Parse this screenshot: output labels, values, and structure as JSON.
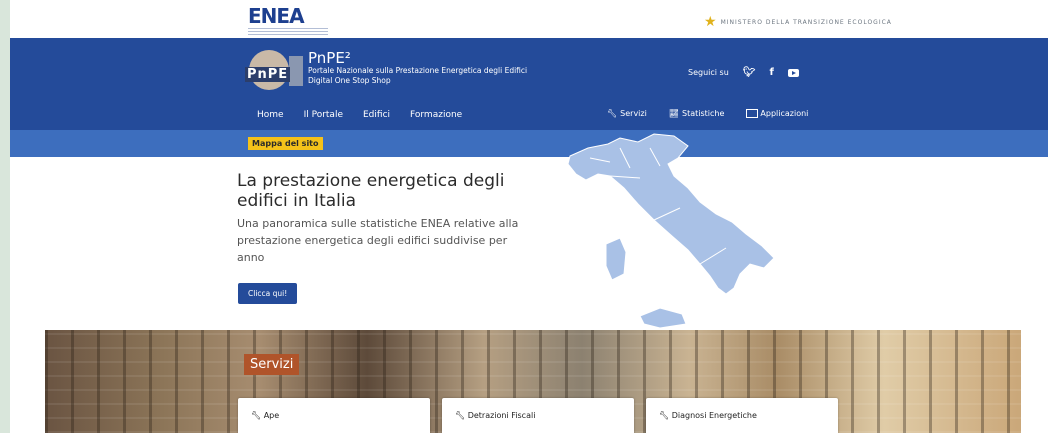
{
  "top": {
    "logo_text": "ENEA",
    "ministero_text": "MINISTERO DELLA TRANSIZIONE ECOLOGICA"
  },
  "header": {
    "logo_text": "PnPE",
    "title": "PnPE²",
    "subtitle_line1": "Portale Nazionale sulla Prestazione Energetica degli Edifici",
    "subtitle_line2": "Digital One Stop Shop",
    "follow_label": "Seguici su"
  },
  "nav": {
    "items": [
      {
        "label": "Home"
      },
      {
        "label": "Il Portale"
      },
      {
        "label": "Edifici"
      },
      {
        "label": "Formazione"
      }
    ],
    "right_items": [
      {
        "label": "Servizi",
        "icon": "wrench-icon"
      },
      {
        "label": "Statistiche",
        "icon": "chart-icon"
      },
      {
        "label": "Applicazioni",
        "icon": "window-icon"
      }
    ]
  },
  "sitemap_label": "Mappa del sito",
  "hero": {
    "title": "La prestazione energetica degli edifici in Italia",
    "subtitle": "Una panoramica sulle statistiche ENEA relative alla prestazione energetica degli edifici suddivise per anno",
    "cta_label": "Clicca qui!"
  },
  "services": {
    "heading": "Servizi",
    "cards": [
      {
        "label": "Ape",
        "icon": "wrench-icon"
      },
      {
        "label": "Detrazioni Fiscali",
        "icon": "wrench-icon"
      },
      {
        "label": "Diagnosi Energetiche",
        "icon": "wrench-icon"
      }
    ]
  },
  "colors": {
    "header_blue": "#244b9a",
    "strip_blue": "#3d6ebe",
    "map_blue": "#a9c1e6",
    "badge_yellow": "#f4c21a",
    "servizi_orange": "#b0542a"
  }
}
